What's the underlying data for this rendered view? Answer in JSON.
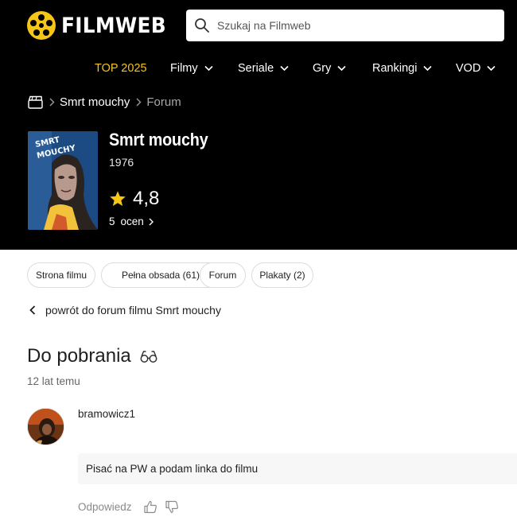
{
  "brand": {
    "name": "FILMWEB"
  },
  "search": {
    "placeholder": "Szukaj na Filmweb",
    "icon": "search-icon"
  },
  "nav": {
    "items": [
      {
        "label": "TOP 2025",
        "has_dropdown": false
      },
      {
        "label": "Filmy",
        "has_dropdown": true
      },
      {
        "label": "Seriale",
        "has_dropdown": true
      },
      {
        "label": "Gry",
        "has_dropdown": true
      },
      {
        "label": "Rankingi",
        "has_dropdown": true
      },
      {
        "label": "VOD",
        "has_dropdown": true
      }
    ]
  },
  "breadcrumb": {
    "film": "Smrt mouchy",
    "section": "Forum"
  },
  "movie": {
    "title": "Smrt mouchy",
    "year": "1976",
    "rating": "4,8",
    "votes_count": "5",
    "votes_label": "ocen",
    "poster_text": "SMRT MOUCHY"
  },
  "tabs": [
    {
      "label": "Strona filmu"
    },
    {
      "label": "Pełna obsada (61)"
    },
    {
      "label": "Forum"
    },
    {
      "label": "Plakaty (2)"
    }
  ],
  "back_link": "powrót do forum filmu Smrt mouchy",
  "thread": {
    "title": "Do pobrania",
    "age": "12 lat temu"
  },
  "post": {
    "author": "bramowicz1",
    "text": "Pisać na PW a podam linka do filmu",
    "reply_label": "Odpowiedz"
  },
  "colors": {
    "accent": "#f5c518",
    "header_bg": "#000000",
    "muted": "#8a8a8a"
  }
}
